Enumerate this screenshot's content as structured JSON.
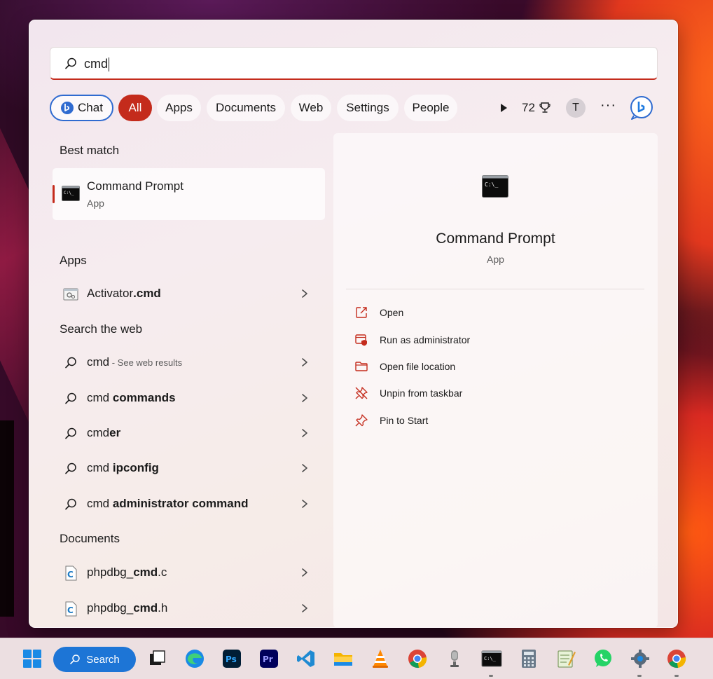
{
  "search": {
    "query": "cmd"
  },
  "filters": {
    "chat": "Chat",
    "all": "All",
    "apps": "Apps",
    "documents": "Documents",
    "web": "Web",
    "settings": "Settings",
    "people": "People",
    "points": "72",
    "avatar_initial": "T"
  },
  "left": {
    "best_match_title": "Best match",
    "best_match": {
      "name": "Command Prompt",
      "type": "App"
    },
    "apps_title": "Apps",
    "apps": [
      {
        "prefix": "Activator",
        "bold": ".cmd"
      }
    ],
    "web_title": "Search the web",
    "web": [
      {
        "prefix": "cmd",
        "bold": "",
        "hint": " - See web results"
      },
      {
        "prefix": "cmd ",
        "bold": "commands",
        "hint": ""
      },
      {
        "prefix": "cmd",
        "bold": "er",
        "hint": ""
      },
      {
        "prefix": "cmd ",
        "bold": "ipconfig",
        "hint": ""
      },
      {
        "prefix": "cmd ",
        "bold": "administrator command",
        "hint": ""
      }
    ],
    "documents_title": "Documents",
    "documents": [
      {
        "prefix": "phpdbg_",
        "bold": "cmd",
        "suffix": ".c"
      },
      {
        "prefix": "phpdbg_",
        "bold": "cmd",
        "suffix": ".h"
      }
    ]
  },
  "preview": {
    "title": "Command Prompt",
    "type": "App",
    "actions": [
      {
        "label": "Open",
        "icon": "open-external-icon"
      },
      {
        "label": "Run as administrator",
        "icon": "run-as-admin-icon"
      },
      {
        "label": "Open file location",
        "icon": "folder-icon"
      },
      {
        "label": "Unpin from taskbar",
        "icon": "unpin-icon"
      },
      {
        "label": "Pin to Start",
        "icon": "pin-icon"
      }
    ]
  },
  "taskbar": {
    "search_label": "Search",
    "apps": [
      "windows-start-icon",
      "task-view-icon",
      "edge-icon",
      "photoshop-icon",
      "premiere-icon",
      "vscode-icon",
      "file-explorer-icon",
      "vlc-icon",
      "chrome-icon",
      "microphone-app-icon",
      "command-prompt-icon",
      "calculator-icon",
      "notepad-icon",
      "whatsapp-icon",
      "settings-icon",
      "chrome-icon-2"
    ]
  },
  "colors": {
    "accent": "#c42b1c",
    "chat_border": "#2f6bd0",
    "taskbar_search": "#1d75d6"
  }
}
